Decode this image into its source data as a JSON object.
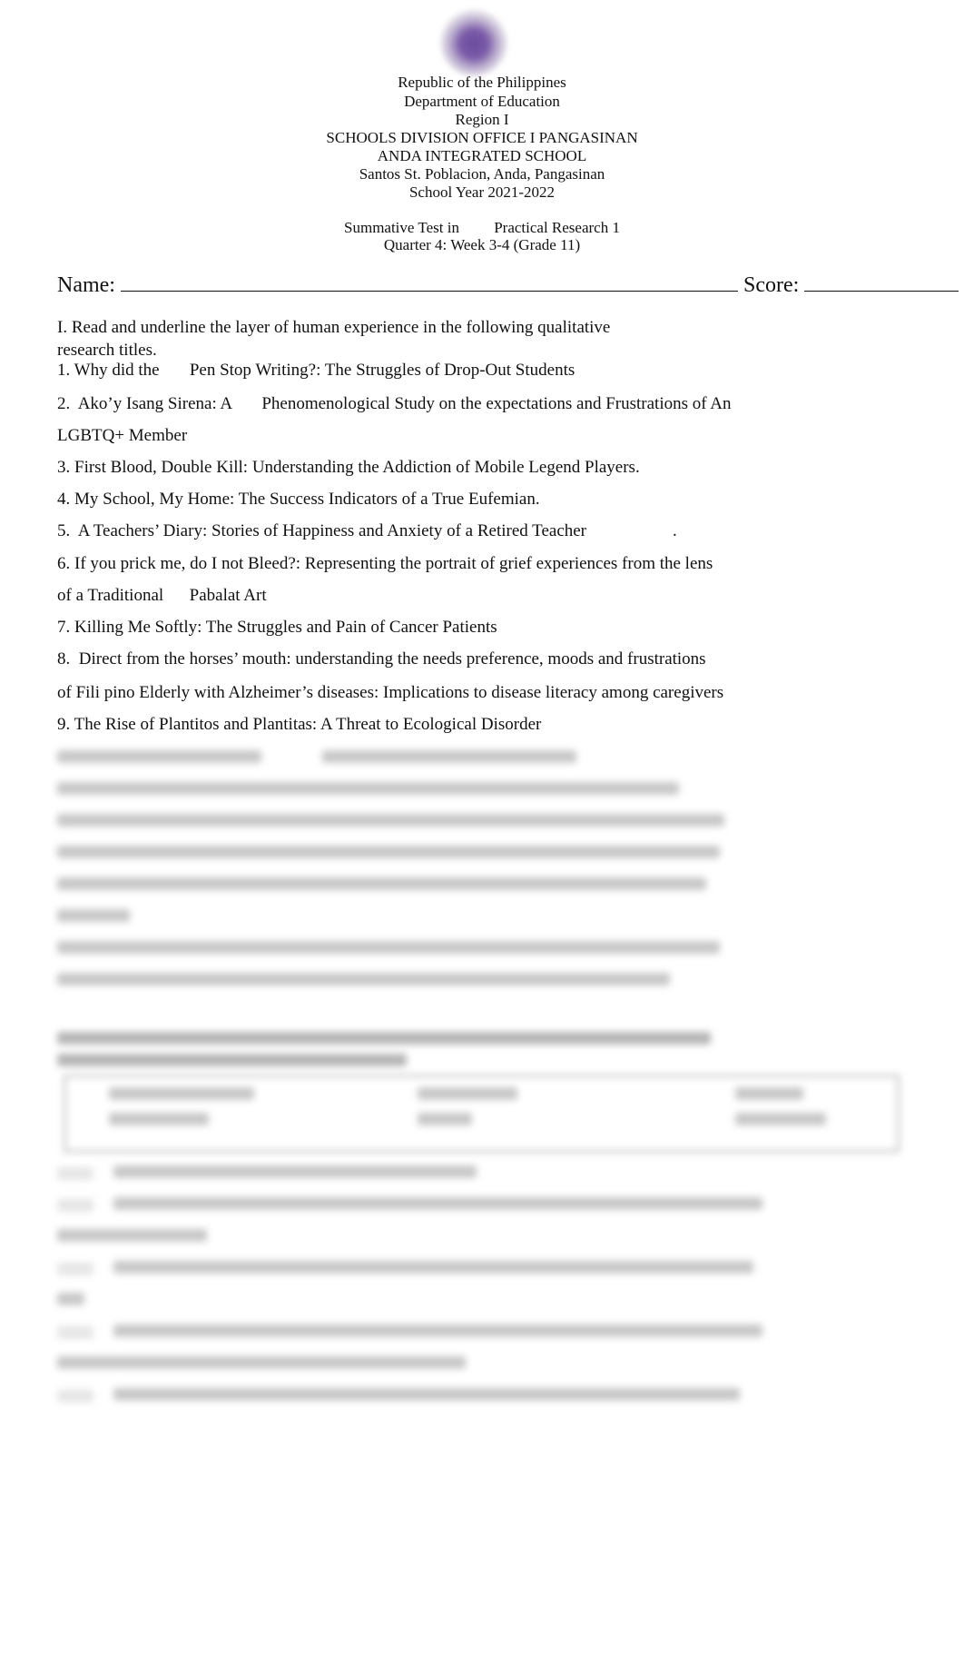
{
  "header": {
    "seal_icon": "deped-seal-icon",
    "lines": [
      "Republic of the Philippines",
      "Department of Education",
      "Region I",
      "SCHOOLS DIVISION OFFICE I PANGASINAN",
      "ANDA INTEGRATED SCHOOL",
      "Santos St. Poblacion, Anda, Pangasinan",
      "School Year 2021-2022"
    ],
    "test_title": "Summative Test in         Practical Research 1",
    "test_subtitle": "Quarter 4: Week 3-4 (Grade 11)"
  },
  "form": {
    "name_label": "Name:",
    "score_label": "Score:"
  },
  "part1": {
    "instruction_line1": "I. Read and underline the layer of human experience in the following qualitative",
    "instruction_line2": "research titles.",
    "items": [
      "1. Why did the       Pen Stop Writing?: The Struggles of Drop-Out Students",
      "2.  Ako’y Isang Sirena: A       Phenomenological Study on the expectations and Frustrations of An",
      "LGBTQ+ Member",
      "3. First Blood, Double Kill: Understanding the Addiction of Mobile Legend Players.",
      "4. My School, My Home: The Success Indicators of a True Eufemian.",
      "5.  A Teachers’ Diary: Stories of Happiness and Anxiety of a Retired Teacher                    .",
      "6. If you prick me, do I not Bleed?: Representing the portrait of grief experiences from the lens",
      "of a Traditional      Pabalat Art",
      "7. Killing Me Softly: The Struggles and Pain of Cancer Patients",
      "8.  Direct from the horses’ mouth: understanding the needs preference, moods and frustrations",
      "of Fili pino Elderly with Alzheimer’s diseases: Implications to disease literacy among caregivers",
      "9. The Rise of Plantitos and Plantitas: A Threat to Ecological Disorder"
    ]
  },
  "obscured_section": {
    "note": "remaining content is blurred and unreadable"
  }
}
